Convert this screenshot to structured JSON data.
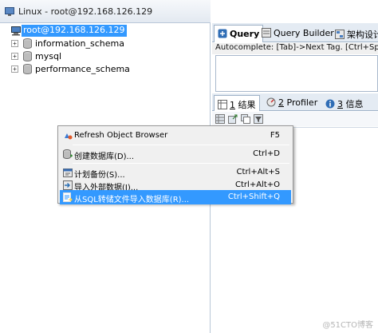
{
  "left_panel": {
    "title": "Linux - root@192.168.126.129",
    "tree": {
      "server": "root@192.168.126.129",
      "databases": [
        "information_schema",
        "mysql",
        "performance_schema"
      ]
    }
  },
  "right_panel": {
    "query_tabs": [
      "Query",
      "Query Builder",
      "架构设计器"
    ],
    "autocomplete": "Autocomplete: [Tab]->Next Tag. [Ctrl+Space]",
    "result_tabs": [
      {
        "num": "1",
        "label": "结果"
      },
      {
        "num": "2",
        "label": "Profiler"
      },
      {
        "num": "3",
        "label": "信息"
      }
    ]
  },
  "context_menu": {
    "items": [
      {
        "label": "Refresh Object Browser",
        "shortcut": "F5"
      },
      {
        "label": "创建数据库(D)...",
        "shortcut": "Ctrl+D"
      },
      {
        "label": "计划备份(S)...",
        "shortcut": "Ctrl+Alt+S"
      },
      {
        "label": "导入外部数据(I)...",
        "shortcut": "Ctrl+Alt+O"
      },
      {
        "label": "从SQL转储文件导入数据库(R)...",
        "shortcut": "Ctrl+Shift+Q"
      }
    ]
  },
  "watermark": "@51CTO博客",
  "colors": {
    "selection": "#3399ff",
    "tab_bar": "#e4ebf3",
    "menu_bg": "#f0f0f0"
  }
}
